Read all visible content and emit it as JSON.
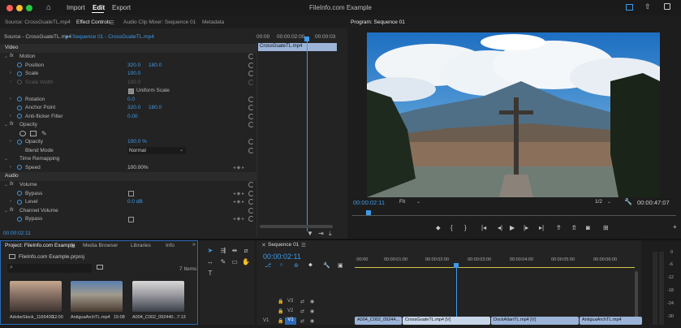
{
  "window": {
    "title": "FileInfo.com Example",
    "menu": [
      "Import",
      "Edit",
      "Export"
    ],
    "active_menu": "Edit"
  },
  "tabs": {
    "source": "Source: CrossGuateTL.mp4",
    "effect_controls": "Effect Controls",
    "audio_mixer": "Audio Clip Mixer: Sequence 01",
    "metadata": "Metadata",
    "program": "Program: Sequence 01"
  },
  "effect_controls": {
    "source_label": "Source - CrossGuateTL.mp4",
    "sequence_label": "Sequence 01 - CrossGuateTL.mp4",
    "times": [
      "00:00",
      "00:00:02:00",
      "00:00:03"
    ],
    "clip_name": "CrossGuateTL.mp4",
    "video_header": "Video",
    "motion": "Motion",
    "position": {
      "label": "Position",
      "x": "320.0",
      "y": "180.0"
    },
    "scale": {
      "label": "Scale",
      "value": "100.0"
    },
    "scale_width": {
      "label": "Scale Width",
      "value": "100.0"
    },
    "uniform_scale": "Uniform Scale",
    "rotation": {
      "label": "Rotation",
      "value": "0.0"
    },
    "anchor_point": {
      "label": "Anchor Point",
      "x": "320.0",
      "y": "180.0"
    },
    "anti_flicker": {
      "label": "Anti-flicker Filter",
      "value": "0.00"
    },
    "opacity_header": "Opacity",
    "opacity": {
      "label": "Opacity",
      "value": "100.0 %"
    },
    "blend_mode": {
      "label": "Blend Mode",
      "value": "Normal"
    },
    "time_remapping": "Time Remapping",
    "speed": {
      "label": "Speed",
      "value": "100.00%"
    },
    "audio_header": "Audio",
    "volume": "Volume",
    "bypass": "Bypass",
    "level": {
      "label": "Level",
      "value": "0.0 dB"
    },
    "channel_volume": "Channel Volume",
    "bypass2": "Bypass",
    "current_time": "00:00:02:11"
  },
  "program": {
    "current_time": "00:00:02:11",
    "fit": "Fit",
    "fraction": "1/2",
    "duration": "00:00:47:07"
  },
  "project": {
    "tabs": [
      "Project: FileInfo.com Example",
      "Media Browser",
      "Libraries",
      "Info"
    ],
    "file": "FileInfo.com Example.prproj",
    "search_placeholder": "",
    "item_count": "7 Items",
    "items": [
      {
        "name": "AdobeStock_1166400...",
        "duration": "12:00"
      },
      {
        "name": "AntiguaArchTL.mp4",
        "duration": "15:08"
      },
      {
        "name": "A004_C002_092440...",
        "duration": "7:13"
      }
    ]
  },
  "timeline": {
    "tab": "Sequence 01",
    "current_time": "00:00:02:11",
    "ruler": [
      ":00:00",
      "00:00:01:00",
      "00:00:02:00",
      "00:00:03:00",
      "00:00:04:00",
      "00:00:05:00",
      "00:00:06:00"
    ],
    "tracks": [
      "V3",
      "V2",
      "V1"
    ],
    "clips": [
      "A004_C002_09244...",
      "CrossGuateTL.mp4 [V]",
      "DockAtlanTL.mp4 [V]",
      "AntiguaArchTL.mp4"
    ],
    "audio_meter": [
      "0",
      "-6",
      "-12",
      "-18",
      "-24",
      "-30"
    ]
  }
}
